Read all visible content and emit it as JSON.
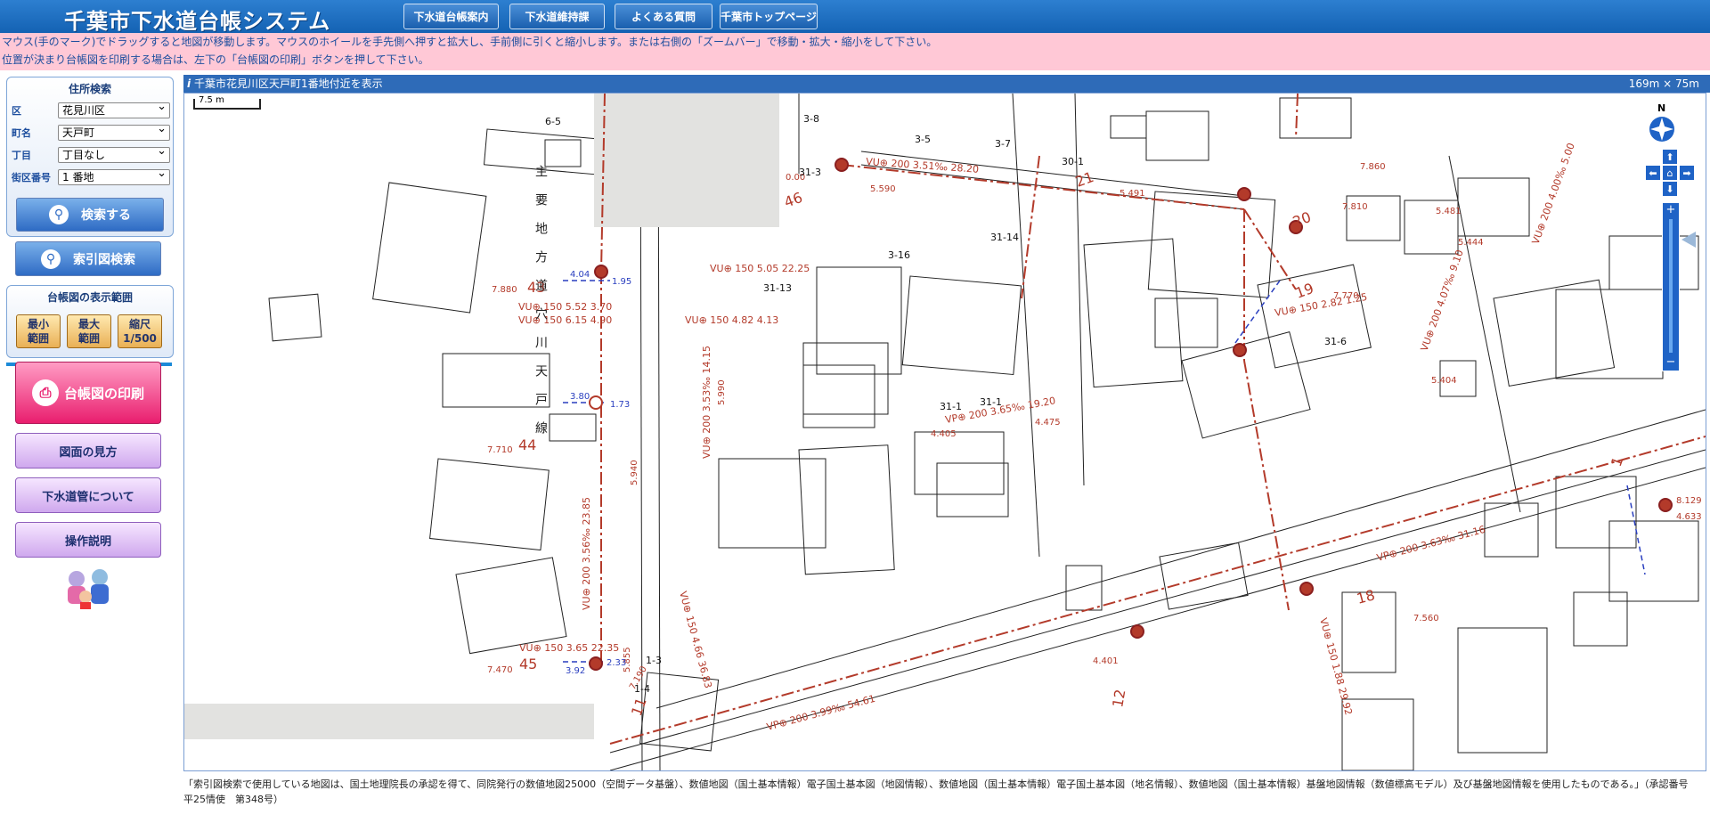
{
  "header": {
    "title": "千葉市下水道台帳システム",
    "nav": [
      "下水道台帳案内",
      "下水道維持課",
      "よくある質問",
      "千葉市トップページ"
    ]
  },
  "notice": {
    "line1": "マウス(手のマーク)でドラッグすると地図が移動します。マウスのホイールを手先側へ押すと拡大し、手前側に引くと縮小します。または右側の「ズームバー」で移動・拡大・縮小をして下さい。",
    "line2": "位置が決まり台帳図を印刷する場合は、左下の「台帳図の印刷」ボタンを押して下さい。"
  },
  "search": {
    "title": "住所検索",
    "fields": [
      {
        "label": "区",
        "value": "花見川区"
      },
      {
        "label": "町名",
        "value": "天戸町"
      },
      {
        "label": "丁目",
        "value": "丁目なし"
      },
      {
        "label": "街区番号",
        "value": "1 番地"
      }
    ],
    "search_button": "検索する"
  },
  "index_button": "索引図検索",
  "range": {
    "title": "台帳図の表示範囲",
    "buttons": [
      "最小\n範囲",
      "最大\n範囲",
      "縮尺\n1/500"
    ]
  },
  "print_button": "台帳図の印刷",
  "menu": [
    "図面の見方",
    "下水道管について",
    "操作説明"
  ],
  "map": {
    "location_text": "千葉市花見川区天戸町1番地付近を表示",
    "extent_text": "169m × 75m",
    "scale_label": "7.5 m",
    "north_label": "N",
    "road_label": "主要地方道穴川天戸線",
    "lot_labels": [
      "6-5",
      "3-8",
      "3-5",
      "3-7",
      "30-1",
      "31-3",
      "31-14",
      "3-16",
      "31-13",
      "31-6",
      "31-1",
      "31-1",
      "1-3",
      "1-4"
    ],
    "sheet_numbers": [
      "43",
      "44",
      "45",
      "46",
      "21",
      "20",
      "19",
      "18",
      "11",
      "12",
      "1"
    ],
    "pipe_labels": [
      "VU⊕ 150 5.05 22.25",
      "VU⊕ 150 5.52 3.70",
      "VU⊕ 150 6.15 4.90",
      "VU⊕ 150 4.82 4.13",
      "VU⊕ 150 3.65 22.35",
      "VU⊕ 200 3.51‰ 28.20",
      "VU⊕ 150 2.82 1.25",
      "VP⊕ 200 3.65‰ 19.20",
      "VP⊕ 200 3.63‰ 31.16",
      "VP⊕ 200 3.99‰ 54.61",
      "VU⊕ 200 4.07‰ 9.10",
      "VU⊕ 200 4.00‰ 5.00",
      "VU⊕ 200 3.56‰ 23.85",
      "VU⊕ 200 3.53‰ 14.15",
      "VU⊕ 150 4.66 36.83",
      "VU⊕ 150 1.88 29.92"
    ],
    "depth_labels": [
      "7.880",
      "7.710",
      "7.470",
      "7.190",
      "5.590",
      "5.491",
      "7.810",
      "7.770",
      "7.860",
      "5.481",
      "5.444",
      "5.404",
      "4.405",
      "4.475",
      "4.401",
      "8.129",
      "4.633",
      "7.560",
      "5.940",
      "5.855",
      "5.990",
      "0.00",
      "4.04",
      "1.95",
      "3.80",
      "1.73",
      "3.92",
      "2.33"
    ]
  },
  "footer": "「索引図検索で使用している地図は、国土地理院長の承認を得て、同院発行の数値地図25000（空間データ基盤）、数値地図（国土基本情報）電子国土基本図（地図情報）、数値地図（国土基本情報）電子国土基本図（地名情報）、数値地図（国土基本情報）基盤地図情報（数値標高モデル）及び基盤地図情報を使用したものである。」（承認番号　平25情使　第348号）",
  "colors": {
    "header": "#1462b3",
    "notice": "#ffc8d6",
    "pipe": "#b33a2a",
    "aux_pipe": "#2a3fbf"
  }
}
